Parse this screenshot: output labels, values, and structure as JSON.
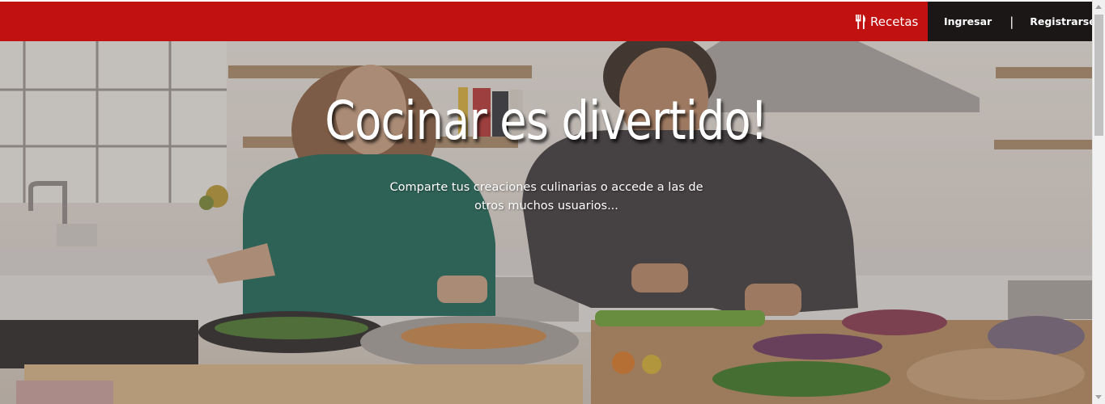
{
  "navbar": {
    "brand_label": "Recetas",
    "brand_icon": "fork-knife-icon",
    "login_label": "Ingresar",
    "separator": "|",
    "register_label": "Registrarse",
    "colors": {
      "navbar_bg": "#c11111",
      "auth_bg": "#1b1717"
    }
  },
  "hero": {
    "title": "Cocinar es divertido!",
    "subtitle": "Comparte tus creaciones culinarias o accede a las de otros muchos usuarios..."
  }
}
